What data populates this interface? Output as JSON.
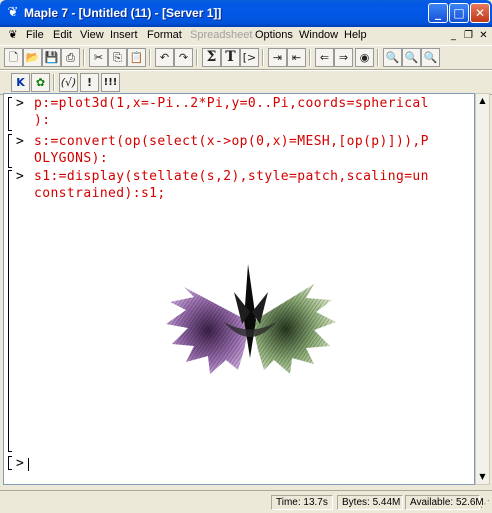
{
  "window": {
    "title": "Maple 7  - [Untitled (11) - [Server 1]]"
  },
  "menu": {
    "items": [
      "File",
      "Edit",
      "View",
      "Insert",
      "Format",
      "Spreadsheet",
      "Options",
      "Window",
      "Help"
    ],
    "disabled": "Spreadsheet"
  },
  "toolbar2": {
    "k_label": "K",
    "paren_label": "(√)",
    "excl_label": "!",
    "triple_excl_label": "!!!"
  },
  "worksheet": {
    "prompt_char": ">",
    "inputs": [
      {
        "line1": "p:=plot3d(1,x=-Pi..2*Pi,y=0..Pi,coords=spherical",
        "line2": "):"
      },
      {
        "line1": "s:=convert(op(select(x->op(0,x)=MESH,[op(p)])),P",
        "line2": "OLYGONS):"
      },
      {
        "line1": "s1:=display(stellate(s,2),style=patch,scaling=un",
        "line2": "constrained):s1;"
      }
    ]
  },
  "status": {
    "time": "Time: 13.7s",
    "bytes": "Bytes: 5.44M",
    "available": "Available: 52.6M"
  }
}
